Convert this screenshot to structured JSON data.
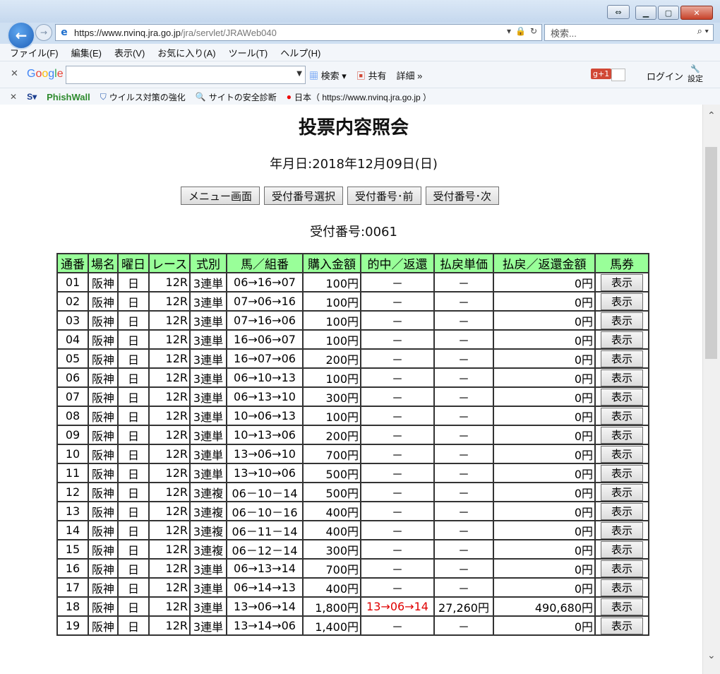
{
  "browser": {
    "url_host": "https://www.nvinq.jra.go.jp",
    "url_path": "/jra/servlet/JRAWeb040",
    "search_placeholder": "検索...",
    "menu": [
      "ファイル(F)",
      "編集(E)",
      "表示(V)",
      "お気に入り(A)",
      "ツール(T)",
      "ヘルプ(H)"
    ],
    "google_toolbar": {
      "logo": "Google",
      "search_btn": "検索",
      "share": "共有",
      "detail": "詳細 »",
      "login": "ログイン",
      "settings": "設定",
      "gplus": "g+1"
    },
    "favorites": {
      "phishwall": "PhishWall",
      "virus": "ウイルス対策の強化",
      "diag": "サイトの安全診断",
      "site": "日本（ https://www.nvinq.jra.go.jp ）"
    }
  },
  "page": {
    "title": "投票内容照会",
    "date": "年月日:2018年12月09日(日)",
    "buttons": {
      "menu": "メニュー画面",
      "select": "受付番号選択",
      "prev": "受付番号･前",
      "next": "受付番号･次"
    },
    "receipt": "受付番号:0061"
  },
  "table": {
    "headers": [
      "通番",
      "場名",
      "曜日",
      "レース",
      "式別",
      "馬／組番",
      "購入金額",
      "的中／返還",
      "払戻単価",
      "払戻／返還金額",
      "馬券"
    ],
    "show_label": "表示",
    "rows": [
      [
        "01",
        "阪神",
        "日",
        "12R",
        "3連単",
        "06→16→07",
        "100円",
        "－",
        "－",
        "0円"
      ],
      [
        "02",
        "阪神",
        "日",
        "12R",
        "3連単",
        "07→06→16",
        "100円",
        "－",
        "－",
        "0円"
      ],
      [
        "03",
        "阪神",
        "日",
        "12R",
        "3連単",
        "07→16→06",
        "100円",
        "－",
        "－",
        "0円"
      ],
      [
        "04",
        "阪神",
        "日",
        "12R",
        "3連単",
        "16→06→07",
        "100円",
        "－",
        "－",
        "0円"
      ],
      [
        "05",
        "阪神",
        "日",
        "12R",
        "3連単",
        "16→07→06",
        "200円",
        "－",
        "－",
        "0円"
      ],
      [
        "06",
        "阪神",
        "日",
        "12R",
        "3連単",
        "06→10→13",
        "100円",
        "－",
        "－",
        "0円"
      ],
      [
        "07",
        "阪神",
        "日",
        "12R",
        "3連単",
        "06→13→10",
        "300円",
        "－",
        "－",
        "0円"
      ],
      [
        "08",
        "阪神",
        "日",
        "12R",
        "3連単",
        "10→06→13",
        "100円",
        "－",
        "－",
        "0円"
      ],
      [
        "09",
        "阪神",
        "日",
        "12R",
        "3連単",
        "10→13→06",
        "200円",
        "－",
        "－",
        "0円"
      ],
      [
        "10",
        "阪神",
        "日",
        "12R",
        "3連単",
        "13→06→10",
        "700円",
        "－",
        "－",
        "0円"
      ],
      [
        "11",
        "阪神",
        "日",
        "12R",
        "3連単",
        "13→10→06",
        "500円",
        "－",
        "－",
        "0円"
      ],
      [
        "12",
        "阪神",
        "日",
        "12R",
        "3連複",
        "06－10－14",
        "500円",
        "－",
        "－",
        "0円"
      ],
      [
        "13",
        "阪神",
        "日",
        "12R",
        "3連複",
        "06－10－16",
        "400円",
        "－",
        "－",
        "0円"
      ],
      [
        "14",
        "阪神",
        "日",
        "12R",
        "3連複",
        "06－11－14",
        "400円",
        "－",
        "－",
        "0円"
      ],
      [
        "15",
        "阪神",
        "日",
        "12R",
        "3連複",
        "06－12－14",
        "300円",
        "－",
        "－",
        "0円"
      ],
      [
        "16",
        "阪神",
        "日",
        "12R",
        "3連単",
        "06→13→14",
        "700円",
        "－",
        "－",
        "0円"
      ],
      [
        "17",
        "阪神",
        "日",
        "12R",
        "3連単",
        "06→14→13",
        "400円",
        "－",
        "－",
        "0円"
      ],
      [
        "18",
        "阪神",
        "日",
        "12R",
        "3連単",
        "13→06→14",
        "1,800円",
        "13→06→14",
        "27,260円",
        "490,680円"
      ],
      [
        "19",
        "阪神",
        "日",
        "12R",
        "3連単",
        "13→14→06",
        "1,400円",
        "－",
        "－",
        "0円"
      ]
    ]
  }
}
